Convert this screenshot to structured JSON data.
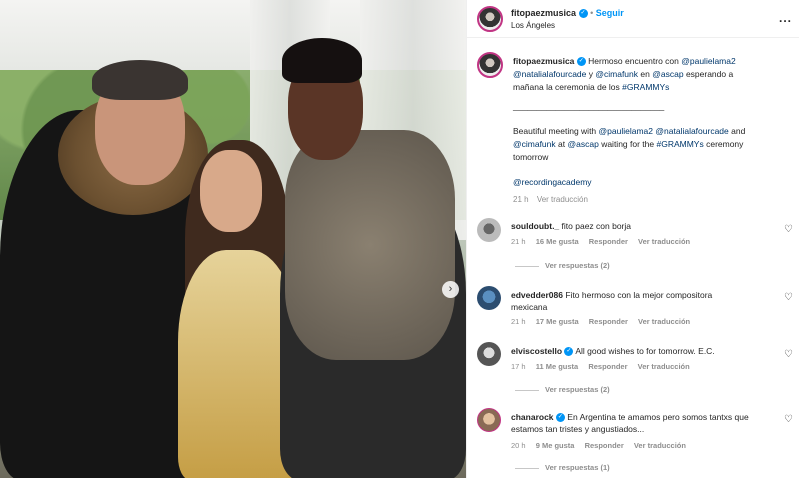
{
  "post": {
    "username": "fitopaezmusica",
    "follow_label": "Seguir",
    "location": "Los Ángeles",
    "caption_user": "fitopaezmusica",
    "caption_line1": "Hermoso encuentro con",
    "mention_paulie": "@paulielama2",
    "mention_natalia": "@natalialafourcade",
    "word_y": "y",
    "mention_cima": "@cimafunk",
    "word_en": "en",
    "mention_ascap": "@ascap",
    "caption_line1_end": "esperando a",
    "caption_line2": "mañana la ceremonia de los",
    "hashtag_grammys": "#GRAMMYs",
    "separator": "________________________________",
    "en_prefix": "Beautiful meeting with",
    "en_and": "and",
    "en_at": "at",
    "en_waiting": "waiting for the",
    "en_ceremony": "ceremony",
    "en_tomorrow": "tomorrow",
    "mention_recording": "@recordingacademy",
    "caption_time": "21 h",
    "caption_translate": "Ver traducción",
    "next_arrow": "›"
  },
  "comments": [
    {
      "username": "souldoubt._",
      "text": "fito paez con borja",
      "time": "21 h",
      "likes": "16 Me gusta",
      "reply": "Responder",
      "translate": "Ver traducción",
      "replies": "Ver respuestas (2)"
    },
    {
      "username": "edvedder086",
      "text": "Fito hermoso con la mejor compositora",
      "text2": "mexicana",
      "time": "21 h",
      "likes": "17 Me gusta",
      "reply": "Responder",
      "translate": "Ver traducción"
    },
    {
      "username": "elviscostello",
      "text": "All good wishes to for tomorrow. E.C.",
      "time": "17 h",
      "likes": "11 Me gusta",
      "reply": "Responder",
      "translate": "Ver traducción",
      "replies": "Ver respuestas (2)"
    },
    {
      "username": "chanarock",
      "text": "En Argentina te amamos pero somos tantxs que",
      "text2": "estamos tan tristes y angustiados...",
      "time": "20 h",
      "likes": "9 Me gusta",
      "reply": "Responder",
      "translate": "Ver traducción",
      "replies": "Ver respuestas (1)"
    }
  ],
  "icons": {
    "more": "...",
    "heart": "♡",
    "verified": "✓"
  },
  "colors": {
    "accent": "#0095f6",
    "link": "#00376b",
    "muted": "#8e8e8e"
  }
}
